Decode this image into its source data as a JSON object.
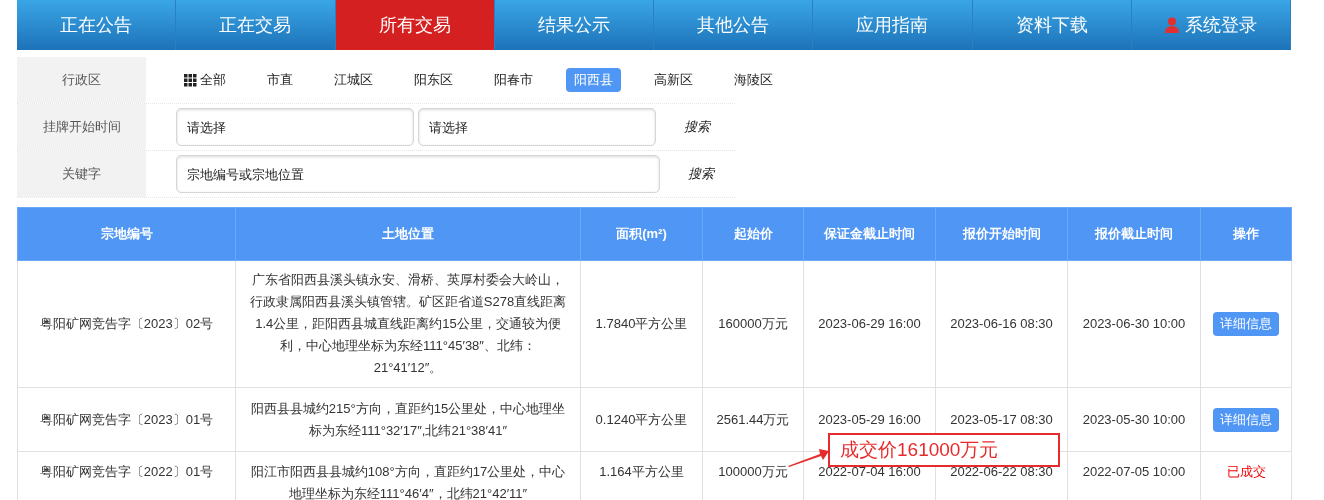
{
  "nav": [
    {
      "label": "正在公告",
      "selected": false,
      "kind": "plain"
    },
    {
      "label": "正在交易",
      "selected": false,
      "kind": "plain"
    },
    {
      "label": "所有交易",
      "selected": true,
      "kind": "plain"
    },
    {
      "label": "结果公示",
      "selected": false,
      "kind": "plain"
    },
    {
      "label": "其他公告",
      "selected": false,
      "kind": "plain"
    },
    {
      "label": "应用指南",
      "selected": false,
      "kind": "plain"
    },
    {
      "label": "资料下载",
      "selected": false,
      "kind": "plain"
    },
    {
      "label": "系统登录",
      "selected": false,
      "kind": "login"
    }
  ],
  "filters": {
    "region": {
      "label": "行政区",
      "options": [
        {
          "label": "全部",
          "selected": false,
          "kind": "all"
        },
        {
          "label": "市直",
          "selected": false,
          "kind": "plain"
        },
        {
          "label": "江城区",
          "selected": false,
          "kind": "plain"
        },
        {
          "label": "阳东区",
          "selected": false,
          "kind": "plain"
        },
        {
          "label": "阳春市",
          "selected": false,
          "kind": "plain"
        },
        {
          "label": "阳西县",
          "selected": true,
          "kind": "plain"
        },
        {
          "label": "高新区",
          "selected": false,
          "kind": "plain"
        },
        {
          "label": "海陵区",
          "selected": false,
          "kind": "plain"
        }
      ]
    },
    "date": {
      "label": "挂牌开始时间",
      "fields": [
        {
          "placeholder": "请选择"
        },
        {
          "placeholder": "请选择"
        }
      ],
      "search": "搜索"
    },
    "keyword": {
      "label": "关键字",
      "placeholder": "宗地编号或宗地位置",
      "search": "搜索"
    }
  },
  "table": {
    "columns": [
      "宗地编号",
      "土地位置",
      "面积(m²)",
      "起始价",
      "保证金截止时间",
      "报价开始时间",
      "报价截止时间",
      "操作"
    ],
    "rows": [
      {
        "cells": [
          "粤阳矿网竞告字〔2023〕02号",
          "广东省阳西县溪头镇永安、滑桥、英厚村委会大岭山，行政隶属阳西县溪头镇管辖。矿区距省道S278直线距离1.4公里，距阳西县城直线距离约15公里，交通较为便利，中心地理坐标为东经111°45′38″、北纬：21°41′12″。",
          "1.7840平方公里",
          "160000万元",
          "2023-06-29 16:00",
          "2023-06-16 08:30",
          "2023-06-30 10:00"
        ],
        "action": {
          "kind": "button",
          "label": "详细信息"
        }
      },
      {
        "cells": [
          "粤阳矿网竞告字〔2023〕01号",
          "阳西县县城约215°方向，直距约15公里处，中心地理坐标为东经111°32′17″,北纬21°38′41″",
          "0.1240平方公里",
          "2561.44万元",
          "2023-05-29 16:00",
          "2023-05-17 08:30",
          "2023-05-30 10:00"
        ],
        "action": {
          "kind": "button",
          "label": "详细信息"
        }
      },
      {
        "cells": [
          "粤阳矿网竞告字〔2022〕01号",
          "阳江市阳西县县城约108°方向，直距约17公里处，中心地理坐标为东经111°46′4″，北纬21°42′11″",
          "1.164平方公里",
          "100000万元",
          "2022-07-04 16:00",
          "2022-06-22 08:30",
          "2022-07-05 10:00"
        ],
        "action": {
          "kind": "status",
          "label": "已成交"
        }
      }
    ]
  },
  "annotation": {
    "text": "成交价161000万元"
  }
}
